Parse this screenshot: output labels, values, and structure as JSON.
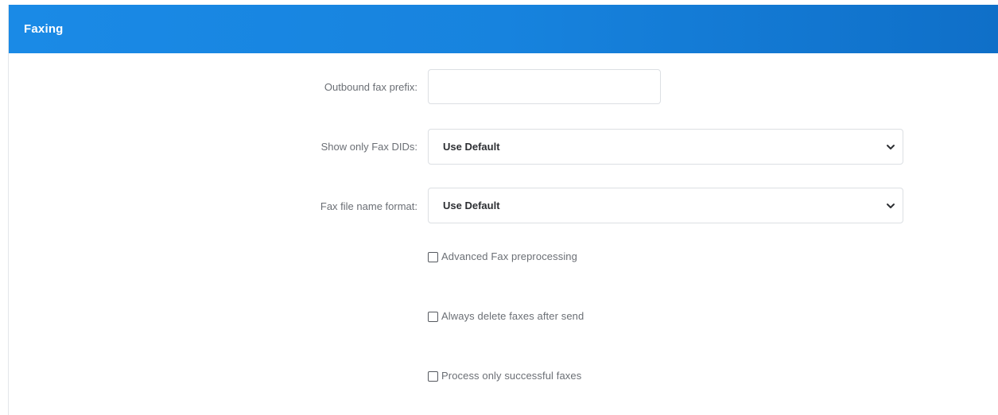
{
  "panel": {
    "title": "Faxing",
    "header_color": "#1783de"
  },
  "fields": {
    "outbound_prefix": {
      "label": "Outbound fax prefix:",
      "value": "",
      "placeholder": ""
    },
    "show_fax_dids": {
      "label": "Show only Fax DIDs:",
      "selected": "Use Default"
    },
    "file_name_format": {
      "label": "Fax file name format:",
      "selected": "Use Default"
    }
  },
  "checkboxes": {
    "advanced_preprocessing": {
      "label": "Advanced Fax preprocessing",
      "checked": false
    },
    "always_delete": {
      "label": "Always delete faxes after send",
      "checked": false
    },
    "process_successful": {
      "label": "Process only successful faxes",
      "checked": false
    }
  }
}
